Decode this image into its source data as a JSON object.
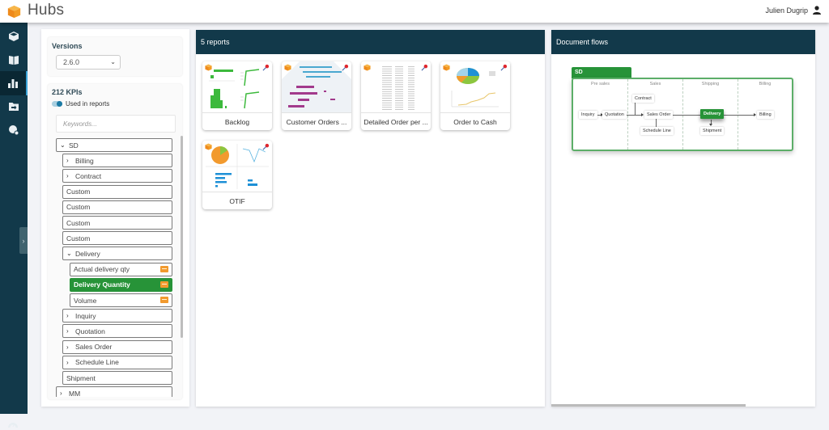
{
  "app": {
    "title": "Hubs",
    "user_name": "Julien Dugrip"
  },
  "colors": {
    "nav_bg": "#12394a",
    "accent_green": "#279338",
    "kpi_badge": "#f29a2e",
    "active_indicator": "#3aa3d8"
  },
  "leftnav": {
    "items": [
      {
        "icon": "cube-icon",
        "active": false
      },
      {
        "icon": "book-icon",
        "active": false
      },
      {
        "icon": "bar-chart-icon",
        "active": true
      },
      {
        "icon": "folder-arrow-icon",
        "active": false
      },
      {
        "icon": "globe-settings-icon",
        "active": false
      }
    ],
    "collapse_icon": "chevron-right-icon",
    "bottom_icon": "dashboard-gauge-icon"
  },
  "filters": {
    "versions_label": "Versions",
    "version_selected": "2.6.0",
    "kpi_count_label": "212 KPIs",
    "toggle_label": "Used in reports",
    "toggle_on": true,
    "search_placeholder": "Keywords...",
    "tree": [
      {
        "label": "SD",
        "level": 0,
        "caret": "down"
      },
      {
        "label": "Billing",
        "level": 1,
        "caret": "right"
      },
      {
        "label": "Contract",
        "level": 1,
        "caret": "right"
      },
      {
        "label": "Custom",
        "level": 1,
        "caret": ""
      },
      {
        "label": "Custom",
        "level": 1,
        "caret": ""
      },
      {
        "label": "Custom",
        "level": 1,
        "caret": ""
      },
      {
        "label": "Custom",
        "level": 1,
        "caret": ""
      },
      {
        "label": "Delivery",
        "level": 1,
        "caret": "down"
      },
      {
        "label": "Actual delivery qty",
        "level": 2,
        "caret": "",
        "kpi": true
      },
      {
        "label": "Delivery Quantity",
        "level": 2,
        "caret": "",
        "kpi": true,
        "selected": true
      },
      {
        "label": "Volume",
        "level": 2,
        "caret": "",
        "kpi": true
      },
      {
        "label": "Inquiry",
        "level": 1,
        "caret": "right"
      },
      {
        "label": "Quotation",
        "level": 1,
        "caret": "right"
      },
      {
        "label": "Sales Order",
        "level": 1,
        "caret": "right"
      },
      {
        "label": "Schedule Line",
        "level": 1,
        "caret": "right"
      },
      {
        "label": "Shipment",
        "level": 1,
        "caret": ""
      },
      {
        "label": "MM",
        "level": 0,
        "caret": "right"
      }
    ]
  },
  "reports": {
    "header": "5 reports",
    "items": [
      {
        "label": "Backlog",
        "thumb": "green-bars"
      },
      {
        "label": "Customer Orders ...",
        "thumb": "purple-bars"
      },
      {
        "label": "Detailed Order per ...",
        "thumb": "table"
      },
      {
        "label": "Order to Cash",
        "thumb": "pie-line"
      },
      {
        "label": "OTIF",
        "thumb": "orange-pie-blue-bars"
      }
    ]
  },
  "flows": {
    "header": "Document flows",
    "group": "SD",
    "lanes": [
      "Pre sales",
      "Sales",
      "Shipping",
      "Billing"
    ],
    "nodes": {
      "inquiry": "Inquiry",
      "quotation": "Quotation",
      "contract": "Contract",
      "sales_order": "Sales Order",
      "schedule_line": "Schedule Line",
      "delivery": "Delivery",
      "shipment": "Shipment",
      "billing": "Billing"
    },
    "active_node": "Delivery"
  }
}
